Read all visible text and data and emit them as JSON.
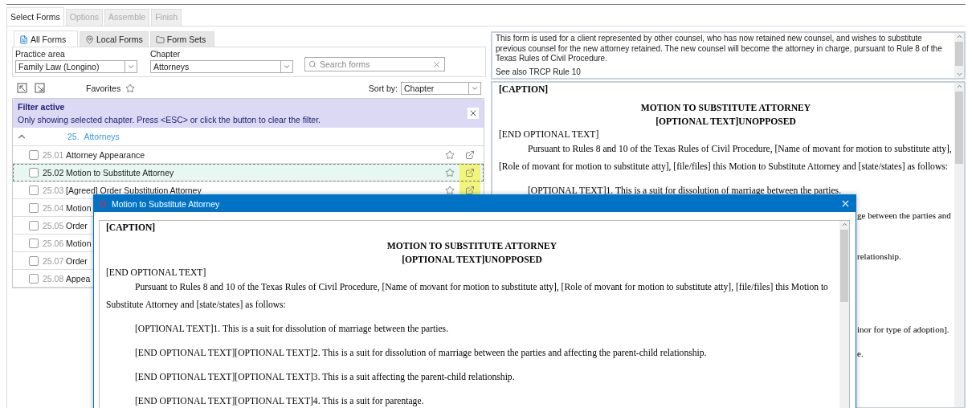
{
  "wizard_tabs": [
    {
      "label": "Select Forms",
      "selected": true,
      "disabled": false
    },
    {
      "label": "Options",
      "selected": false,
      "disabled": true
    },
    {
      "label": "Assemble",
      "selected": false,
      "disabled": true
    },
    {
      "label": "Finish",
      "selected": false,
      "disabled": true
    }
  ],
  "source_tabs": [
    {
      "label": "All Forms",
      "selected": true,
      "kind": "document"
    },
    {
      "label": "Local Forms",
      "selected": false,
      "kind": "pin"
    },
    {
      "label": "Form Sets",
      "selected": false,
      "kind": "folder"
    }
  ],
  "practice_area": {
    "label": "Practice area",
    "value": "Family Law (Longino)"
  },
  "chapter": {
    "label": "Chapter",
    "value": "Attorneys"
  },
  "search": {
    "placeholder": "Search forms"
  },
  "favorites_label": "Favorites",
  "sort": {
    "label": "Sort by:",
    "value": "Chapter"
  },
  "filter_banner": {
    "title": "Filter active",
    "message": "Only showing selected chapter. Press <ESC> or click the button to clear the filter."
  },
  "group": {
    "number": "25.",
    "title": "Attorneys",
    "expanded": true
  },
  "forms": [
    {
      "number": "25.01",
      "title": "Attorney Appearance",
      "selected": false,
      "checked": false,
      "kind": "full",
      "highlighted": false
    },
    {
      "number": "25.02",
      "title": "Motion to Substitute Attorney",
      "selected": true,
      "checked": false,
      "kind": "full",
      "highlighted": true
    },
    {
      "number": "25.03",
      "title": "[Agreed] Order Substitution Attorney",
      "selected": false,
      "checked": false,
      "kind": "full",
      "highlighted": true
    },
    {
      "number": "25.04",
      "title": "Motion",
      "selected": false,
      "checked": false,
      "kind": "covered"
    },
    {
      "number": "25.05",
      "title": "Order",
      "selected": false,
      "checked": false,
      "kind": "covered"
    },
    {
      "number": "25.06",
      "title": "Motion",
      "selected": false,
      "checked": false,
      "kind": "covered"
    },
    {
      "number": "25.07",
      "title": "Order",
      "selected": false,
      "checked": false,
      "kind": "covered"
    },
    {
      "number": "25.08",
      "title": "Appea",
      "selected": false,
      "checked": false,
      "kind": "covered"
    }
  ],
  "description": [
    "This form is used for a client represented by other counsel, who has now retained new counsel, and wishes to substitute previous counsel for the new attorney retained.  The new counsel will become the attorney in charge, pursuant to Rule 8 of the Texas Rules of Civil Procedure.",
    "See also TRCP Rule 10"
  ],
  "preview": {
    "lines": [
      {
        "kind": "caption",
        "text": "[CAPTION]"
      },
      {
        "kind": "title",
        "text": "MOTION TO SUBSTITUTE ATTORNEY"
      },
      {
        "kind": "title",
        "text": "[OPTIONAL TEXT]UNOPPOSED"
      },
      {
        "kind": "plain",
        "text": "[END OPTIONAL TEXT]"
      },
      {
        "kind": "paragraph",
        "text": "Pursuant to Rules 8 and 10 of the Texas Rules of Civil Procedure, [Name of movant for motion to substitute atty], [Role of movant for motion to substitute atty], [file/files] this Motion to Substitute Attorney and [state/states] as follows:"
      },
      {
        "kind": "item",
        "text": "[OPTIONAL TEXT]1.  This is a suit for dissolution of marriage between the parties."
      }
    ],
    "fragments": [
      "ge between the parties and",
      "relationship.",
      "inor for type of adoption].",
      "e."
    ]
  },
  "dialog": {
    "title": "Motion to Substitute Attorney",
    "lines": [
      {
        "kind": "caption",
        "text": "[CAPTION]"
      },
      {
        "kind": "title",
        "text": "MOTION TO SUBSTITUTE ATTORNEY"
      },
      {
        "kind": "title",
        "text": "[OPTIONAL TEXT]UNOPPOSED"
      },
      {
        "kind": "plain",
        "text": "[END OPTIONAL TEXT]"
      },
      {
        "kind": "paragraph",
        "text": "Pursuant to Rules 8 and 10 of the Texas Rules of Civil Procedure, [Name of movant for motion to substitute atty], [Role of movant for motion to substitute atty], [file/files] this Motion to Substitute Attorney and [state/states] as follows:"
      },
      {
        "kind": "item",
        "text": "[OPTIONAL TEXT]1.  This is a suit for dissolution of marriage between the parties."
      },
      {
        "kind": "item",
        "text": "[END OPTIONAL TEXT][OPTIONAL TEXT]2.  This is a suit for dissolution of marriage between the parties and affecting the parent-child relationship."
      },
      {
        "kind": "item",
        "text": "[END OPTIONAL TEXT][OPTIONAL TEXT]3.  This is a suit affecting the parent-child relationship."
      },
      {
        "kind": "item",
        "text": "[END OPTIONAL TEXT][OPTIONAL TEXT]4.  This is a suit for parentage."
      }
    ]
  }
}
